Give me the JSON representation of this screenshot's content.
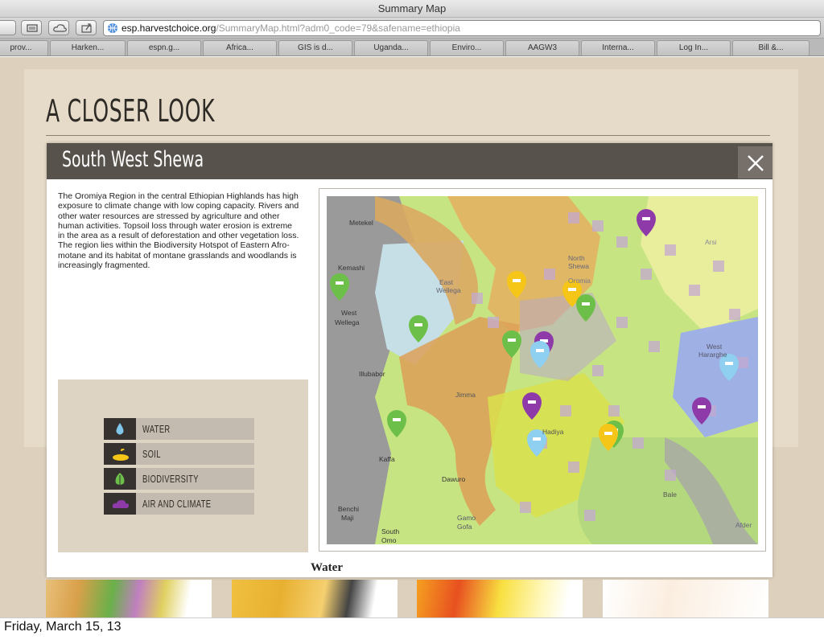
{
  "browser": {
    "window_title": "Summary Map",
    "url_host": "esp.harvestchoice.org",
    "url_path": "/SummaryMap.html?adm0_code=79&safename=ethiopia",
    "bookmarks": [
      "prov...",
      "Harken...",
      "espn.g...",
      "Africa...",
      "GIS is d...",
      "Uganda...",
      "Enviro...",
      "AAGW3",
      "Interna...",
      "Log In...",
      "Bill &..."
    ]
  },
  "page": {
    "title": "A CLOSER LOOK"
  },
  "modal": {
    "title": "South West Shewa",
    "description": "The Oromiya Region in the central Ethiopian Highlands has high exposure to climate change with low coping capacity. Rivers and other water resources are stressed by agriculture and other human activities. Topsoil loss through water erosion is extreme in the area as a result of deforestation and other vegetation loss. The region lies within the Biodiversity Hotspot of Eastern Afro-motane and its habitat of montane grasslands and woodlands is increasingly fragmented.",
    "legend": [
      {
        "label": "WATER",
        "icon": "water-drop-icon",
        "color": "#7fc6ea"
      },
      {
        "label": "SOIL",
        "icon": "plant-soil-icon",
        "color": "#f5c518"
      },
      {
        "label": "BIODIVERSITY",
        "icon": "leaf-icon",
        "color": "#6cc04a"
      },
      {
        "label": "AIR AND CLIMATE",
        "icon": "cloud-icon",
        "color": "#8e3aa8"
      }
    ],
    "map_labels": [
      "Metekel",
      "Kemashi",
      "West Wellega",
      "East Wellega",
      "Illubabor",
      "Jimma",
      "Kaffa",
      "Dawuro",
      "Bench Maji",
      "South Omo",
      "Gamo Gofa",
      "Hadiya",
      "Bale",
      "West Hararghe",
      "Arsi",
      "Afder",
      "Oromia",
      "North Shewa"
    ],
    "section_label": "Water"
  },
  "footer": {
    "date": "Friday, March 15, 13"
  }
}
